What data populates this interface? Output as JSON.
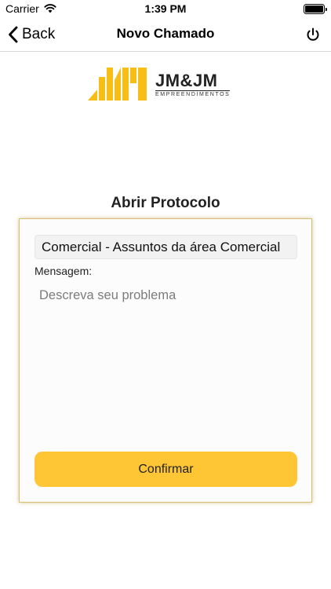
{
  "status_bar": {
    "carrier": "Carrier",
    "time": "1:39 PM",
    "battery_level": 1.0
  },
  "nav": {
    "back_label": "Back",
    "title": "Novo Chamado"
  },
  "logo": {
    "name": "JM&JM",
    "subtitle": "EMPREENDIMENTOS",
    "brand_color": "#f7be16"
  },
  "form": {
    "heading": "Abrir Protocolo",
    "category_value": "Comercial - Assuntos da área Comercial",
    "message_label": "Mensagem:",
    "message_placeholder": "Descreva seu problema",
    "confirm_label": "Confirmar",
    "accent_color": "#fec534"
  }
}
